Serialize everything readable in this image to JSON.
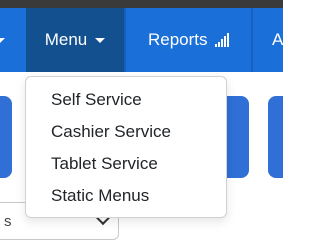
{
  "navbar": {
    "menu_label": "Menu",
    "reports_label": "Reports",
    "next_label_partial": "A"
  },
  "dropdown": {
    "items": [
      {
        "label": "Self Service"
      },
      {
        "label": "Cashier Service"
      },
      {
        "label": "Tablet Service"
      },
      {
        "label": "Static Menus"
      }
    ]
  },
  "page": {
    "select_fragment": "s"
  },
  "colors": {
    "navbar": "#1a6fd8",
    "navbar_active": "#13508f",
    "top_strip": "#3a3a3a",
    "panel": "#2f6fd6"
  },
  "icons": {
    "menu_caret": "chevron-down-icon",
    "reports_signal": "signal-bars-icon",
    "select_chevron": "chevron-down-icon"
  }
}
